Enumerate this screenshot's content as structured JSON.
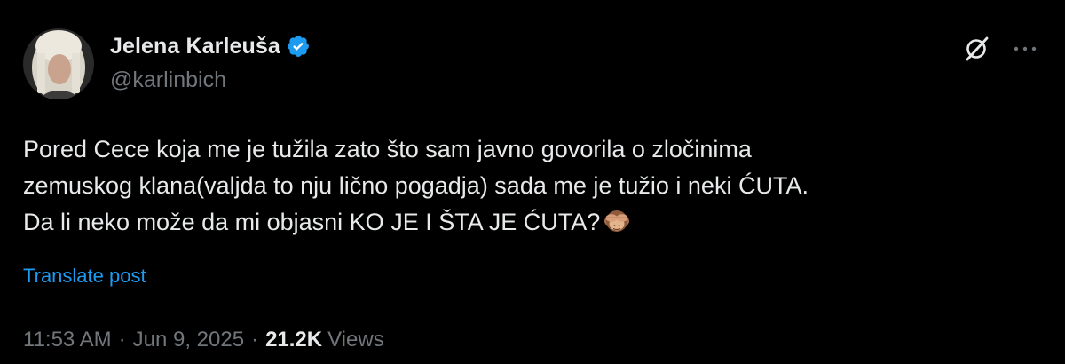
{
  "author": {
    "display_name": "Jelena Karleuša",
    "handle": "@karlinbich",
    "verified": true
  },
  "tweet": {
    "lines": [
      "Pored Cece koja me je tužila zato što sam javno govorila o zločinima",
      "zemuskog klana(valjda to nju lično pogadja) sada me je tužio i neki ĆUTA.",
      "Da li neko može da mi objasni KO JE I ŠTA JE ĆUTA?"
    ],
    "emoji": "see-no-evil-monkey",
    "translate_label": "Translate post"
  },
  "meta": {
    "time": "11:53 AM",
    "separator": "·",
    "date": "Jun 9, 2025",
    "views_count": "21.2K",
    "views_label": "Views"
  },
  "icons": {
    "grok": "grok-icon",
    "more": "more-options-icon",
    "verified": "verified-badge-icon"
  },
  "colors": {
    "background": "#000000",
    "text": "#e7e9ea",
    "muted": "#71767b",
    "link": "#1d9bf0",
    "verified": "#1d9bf0"
  }
}
